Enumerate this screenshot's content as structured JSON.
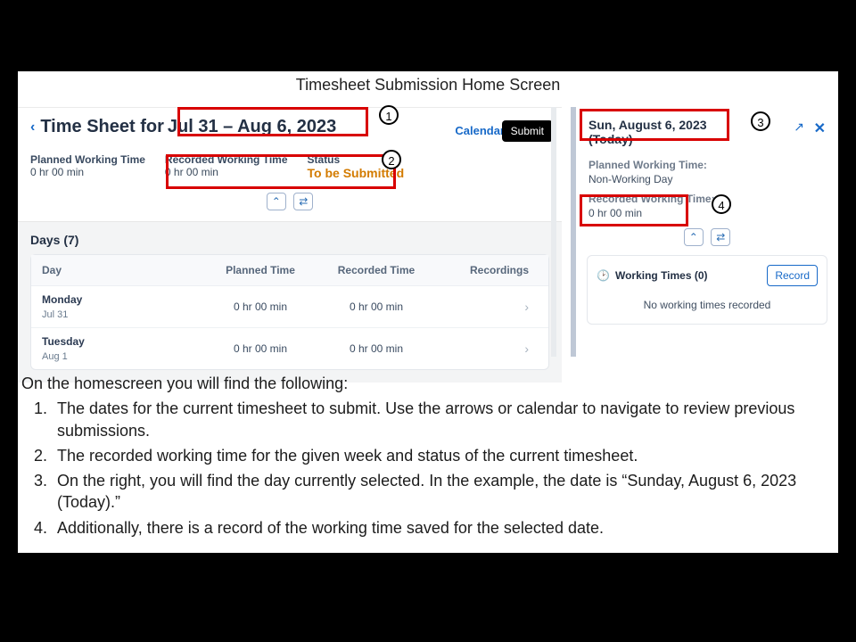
{
  "doc_title": "Timesheet Submission Home Screen",
  "header": {
    "prefix": "Time Sheet for",
    "date_range": "Jul 31 – Aug 6, 2023",
    "calendar_link": "Calendar",
    "submit_label": "Submit"
  },
  "stats": {
    "planned_label": "Planned Working Time",
    "planned_value": "0 hr  00 min",
    "recorded_label": "Recorded Working Time",
    "recorded_value": "0 hr  00 min",
    "status_label": "Status",
    "status_value": "To be Submitted"
  },
  "days": {
    "heading": "Days (7)",
    "cols": {
      "day": "Day",
      "planned": "Planned Time",
      "recorded": "Recorded Time",
      "recordings": "Recordings"
    },
    "rows": [
      {
        "name": "Monday",
        "date": "Jul 31",
        "planned": "0 hr  00 min",
        "recorded": "0 hr  00 min"
      },
      {
        "name": "Tuesday",
        "date": "Aug 1",
        "planned": "0 hr  00 min",
        "recorded": "0 hr  00 min"
      }
    ]
  },
  "right": {
    "date_line1": "Sun, August 6, 2023",
    "date_line2": "(Today)",
    "planned_label": "Planned Working Time:",
    "planned_value": "Non-Working Day",
    "recorded_label": "Recorded Working Time:",
    "recorded_value": "0 hr 00 min",
    "wt_heading": "Working Times (0)",
    "record_btn": "Record",
    "wt_empty": "No working times recorded"
  },
  "explanation": {
    "intro": "On the homescreen you will find the following:",
    "items": [
      "The dates for the current timesheet to submit. Use the arrows or calendar to navigate to review previous submissions.",
      "The recorded working time for the given week and status of the current timesheet.",
      "On the right, you will find the day currently selected. In the example, the date is “Sunday, August 6, 2023 (Today).”",
      "Additionally, there is a record of the working time saved for the selected date."
    ]
  },
  "markers": {
    "m1": "1",
    "m2": "2",
    "m3": "3",
    "m4": "4"
  }
}
